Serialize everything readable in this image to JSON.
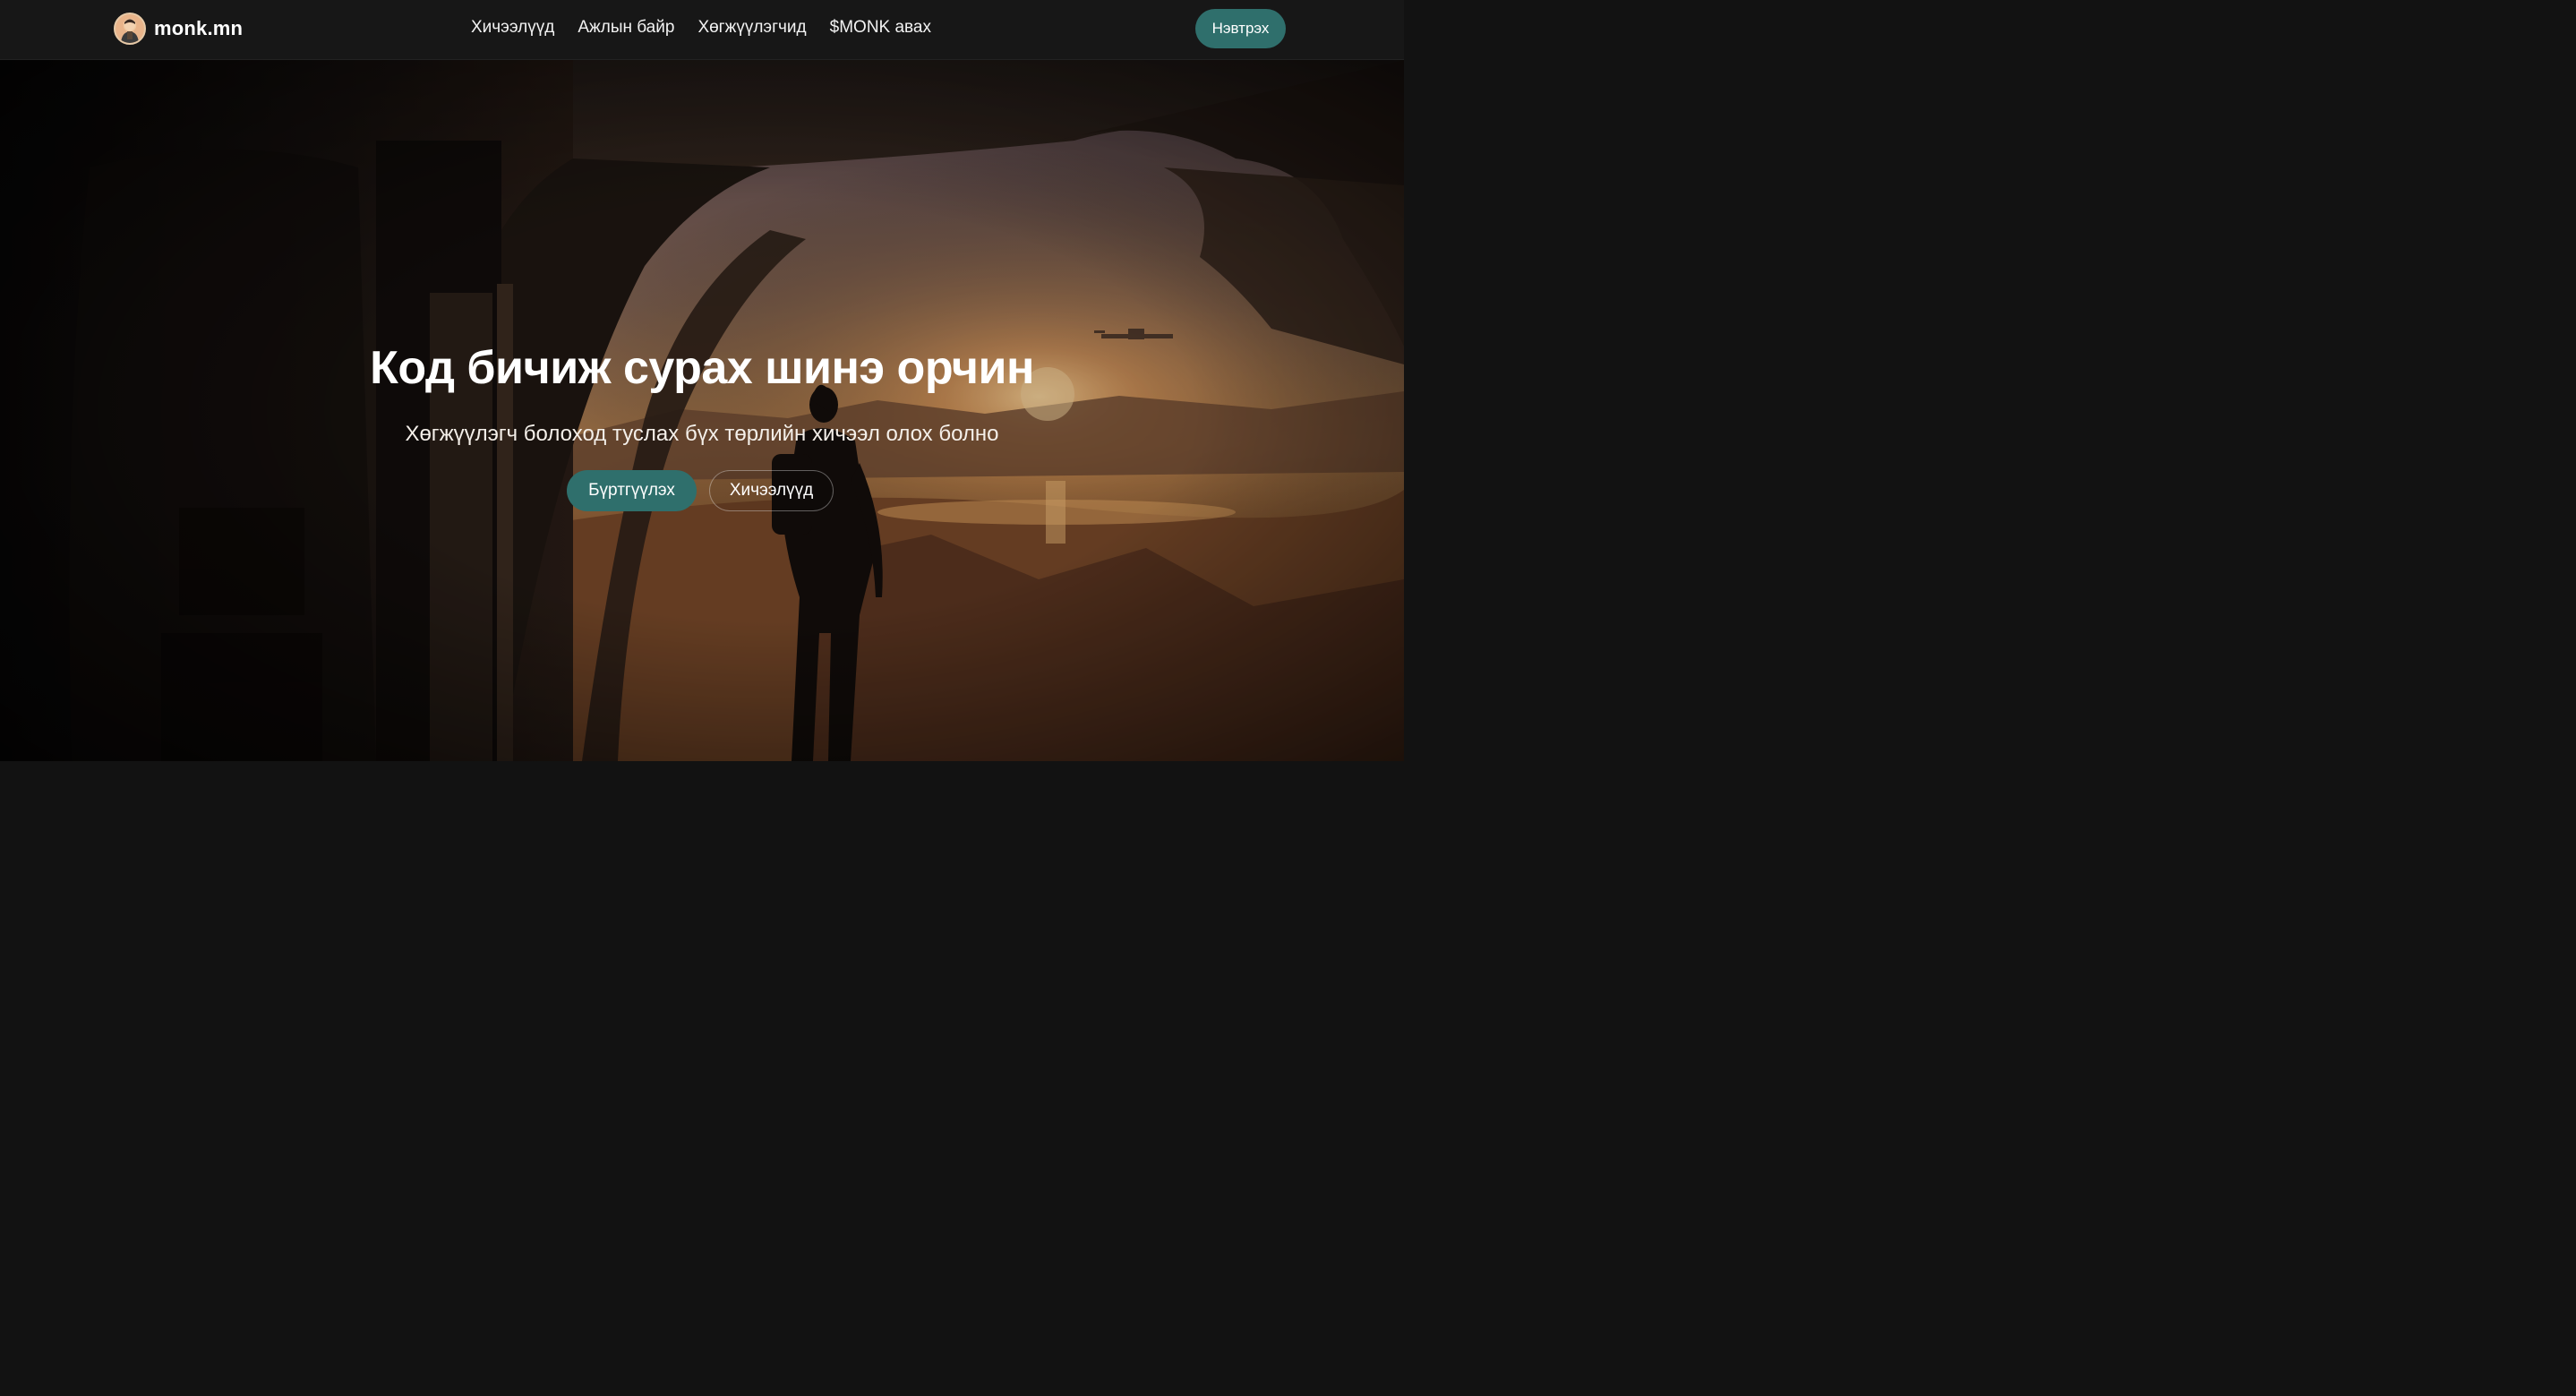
{
  "navbar": {
    "brand": {
      "name": "monk.mn",
      "logo_icon": "monk-avatar-icon"
    },
    "links": [
      {
        "label": "Хичээлүүд"
      },
      {
        "label": "Ажлын байр"
      },
      {
        "label": "Хөгжүүлэгчид"
      },
      {
        "label": "$MONK авах"
      }
    ],
    "login_label": "Нэвтрэх"
  },
  "hero": {
    "title": "Код бичиж сурах шинэ орчин",
    "subtitle": "Хөгжүүлэгч болоход туслах бүх төрлийн хичээл олох болно",
    "primary_cta": "Бүртгүүлэх",
    "secondary_cta": "Хичээлүүд",
    "background": "sci-fi-desert-landscape-image"
  },
  "colors": {
    "accent": "#2f6f6c",
    "navbar_bg": "#171717",
    "text": "#ffffff"
  }
}
